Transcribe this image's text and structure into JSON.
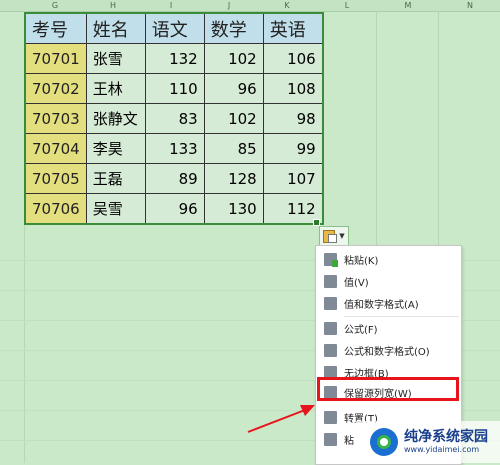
{
  "columns": [
    "G",
    "H",
    "I",
    "J",
    "K",
    "L",
    "M",
    "N"
  ],
  "table": {
    "headers": [
      "考号",
      "姓名",
      "语文",
      "数学",
      "英语"
    ],
    "rows": [
      [
        "70701",
        "张雪",
        "132",
        "102",
        "106"
      ],
      [
        "70702",
        "王林",
        "110",
        "96",
        "108"
      ],
      [
        "70703",
        "张静文",
        "83",
        "102",
        "98"
      ],
      [
        "70704",
        "李昊",
        "133",
        "85",
        "99"
      ],
      [
        "70705",
        "王磊",
        "89",
        "128",
        "107"
      ],
      [
        "70706",
        "吴雪",
        "96",
        "130",
        "112"
      ]
    ]
  },
  "paste_menu": {
    "items": [
      {
        "label": "粘贴(K)",
        "icon": "paste-icon"
      },
      {
        "label": "值(V)",
        "icon": "paste-values-icon"
      },
      {
        "label": "值和数字格式(A)",
        "icon": "paste-values-number-format-icon"
      },
      {
        "label": "公式(F)",
        "icon": "paste-formula-icon"
      },
      {
        "label": "公式和数字格式(O)",
        "icon": "paste-formula-number-format-icon"
      },
      {
        "label": "无边框(B)",
        "icon": "paste-no-border-icon"
      },
      {
        "label": "保留源列宽(W)",
        "icon": "keep-source-width-icon"
      },
      {
        "label": "转置(T)",
        "icon": "transpose-icon"
      },
      {
        "label": "粘",
        "icon": "paste-link-icon"
      }
    ]
  },
  "watermark": {
    "title": "纯净系统家园",
    "url": "www.yidaimei.com"
  },
  "colors": {
    "sheet_background": "#c9e9c9",
    "header_fill": "#c0dfea",
    "id_fill": "#e4df7e",
    "highlight": "#e8141c"
  }
}
